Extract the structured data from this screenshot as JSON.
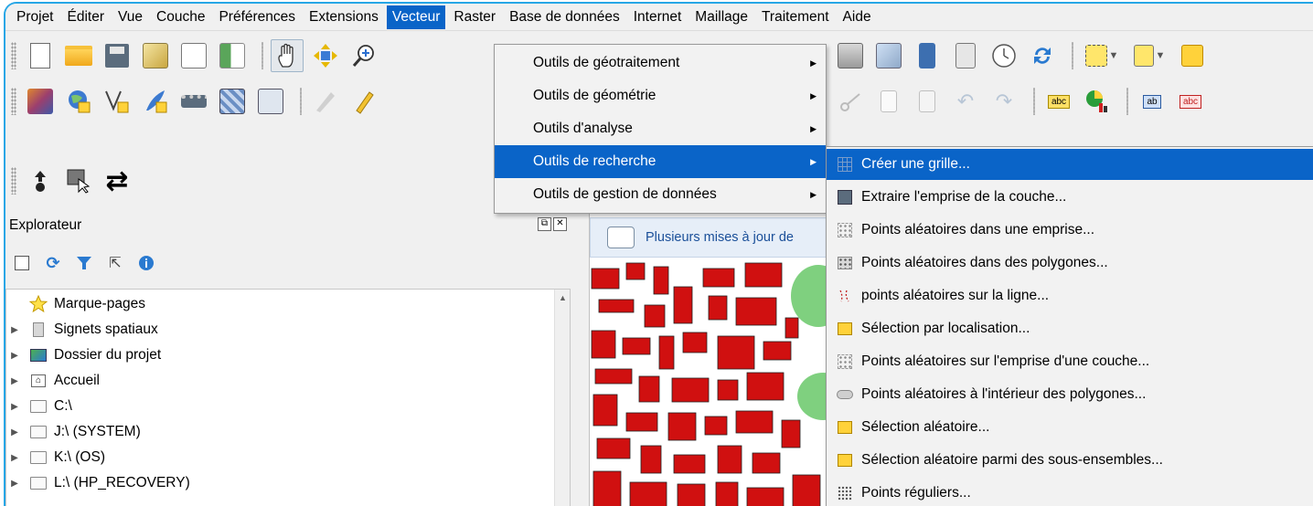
{
  "menubar": {
    "items": [
      "Projet",
      "Éditer",
      "Vue",
      "Couche",
      "Préférences",
      "Extensions",
      "Vecteur",
      "Raster",
      "Base de données",
      "Internet",
      "Maillage",
      "Traitement",
      "Aide"
    ],
    "active": "Vecteur"
  },
  "vector_menu": {
    "items": [
      {
        "label": "Outils de géotraitement"
      },
      {
        "label": "Outils de géométrie"
      },
      {
        "label": "Outils d'analyse"
      },
      {
        "label": "Outils de recherche"
      },
      {
        "label": "Outils de gestion de données"
      }
    ],
    "selected": "Outils de recherche",
    "arrow": "▶"
  },
  "research_submenu": {
    "items": [
      {
        "label": "Créer une grille...",
        "icon": "grid-icon"
      },
      {
        "label": "Extraire l'emprise de la couche...",
        "icon": "extent-icon"
      },
      {
        "label": "Points aléatoires dans une emprise...",
        "icon": "random-points-icon"
      },
      {
        "label": "Points aléatoires dans des polygones...",
        "icon": "random-points-polygon-icon"
      },
      {
        "label": "points aléatoires sur la ligne...",
        "icon": "random-points-line-icon"
      },
      {
        "label": "Sélection par localisation...",
        "icon": "select-location-icon"
      },
      {
        "label": "Points aléatoires sur l'emprise d'une couche...",
        "icon": "random-points-extent-icon"
      },
      {
        "label": "Points aléatoires à l'intérieur des polygones...",
        "icon": "random-points-inside-icon"
      },
      {
        "label": "Sélection aléatoire...",
        "icon": "random-selection-icon"
      },
      {
        "label": "Sélection aléatoire parmi des sous-ensembles...",
        "icon": "random-subset-icon"
      },
      {
        "label": "Points réguliers...",
        "icon": "regular-points-icon"
      }
    ],
    "selected": "Créer une grille..."
  },
  "explorer": {
    "title": "Explorateur",
    "tree": [
      {
        "label": "Marque-pages",
        "icon": "star-icon",
        "arrow": false
      },
      {
        "label": "Signets spatiaux",
        "icon": "bookmark-icon",
        "arrow": true
      },
      {
        "label": "Dossier du projet",
        "icon": "project-folder-icon",
        "arrow": true
      },
      {
        "label": "Accueil",
        "icon": "home-icon",
        "arrow": true
      },
      {
        "label": "C:\\",
        "icon": "drive-icon",
        "arrow": true
      },
      {
        "label": "J:\\ (SYSTEM)",
        "icon": "drive-icon",
        "arrow": true
      },
      {
        "label": "K:\\ (OS)",
        "icon": "drive-icon",
        "arrow": true
      },
      {
        "label": "L:\\ (HP_RECOVERY)",
        "icon": "drive-icon",
        "arrow": true
      }
    ]
  },
  "map": {
    "notification": "Plusieurs mises à jour de"
  },
  "colors": {
    "accent": "#0a64c8",
    "frame": "#27a6e6",
    "building_red": "#d01010",
    "park_green": "#7fd07f"
  }
}
